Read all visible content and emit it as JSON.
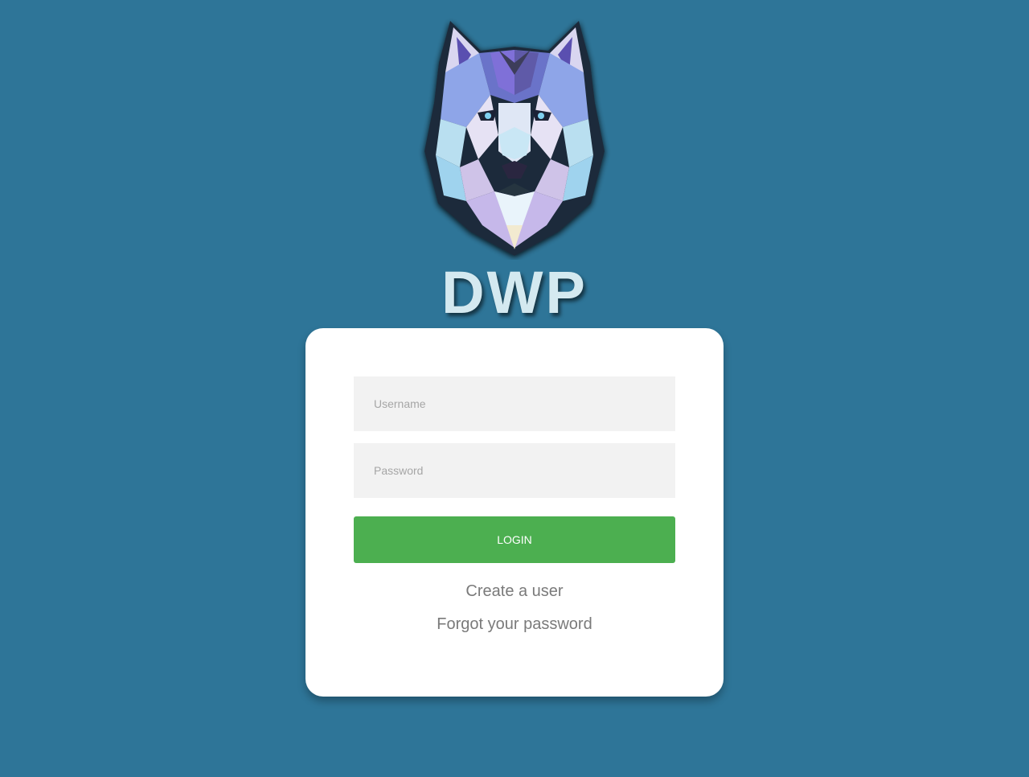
{
  "brand": {
    "title": "DWP",
    "logo_icon": "wolf-head-logo-icon"
  },
  "colors": {
    "background": "#2e7598",
    "card": "#ffffff",
    "field_bg": "#f2f2f2",
    "login_button": "#4caf50",
    "link_text": "#7a7a7a",
    "brand_text": "#d4e9f0"
  },
  "login_form": {
    "username": {
      "value": "",
      "placeholder": "Username"
    },
    "password": {
      "value": "",
      "placeholder": "Password"
    },
    "login_label": "LOGIN",
    "create_user_label": "Create a user",
    "forgot_password_label": "Forgot your password"
  }
}
